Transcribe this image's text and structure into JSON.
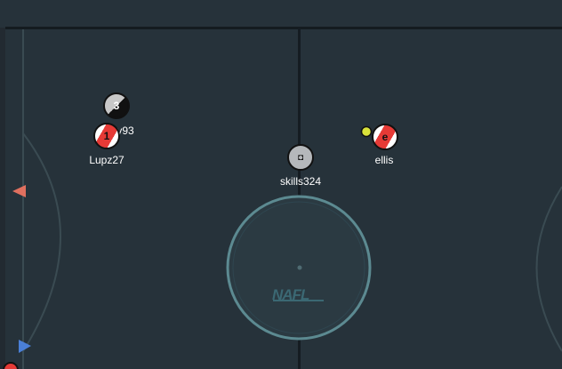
{
  "players": [
    {
      "id": "p3",
      "name": "A         lay93",
      "number": "3",
      "team": "blue"
    },
    {
      "id": "p1",
      "name": "Lupz27",
      "number": "1",
      "team": "red"
    },
    {
      "id": "pskills",
      "name": "skills324",
      "number": "",
      "team": "neutral"
    },
    {
      "id": "pellis",
      "name": "ellis",
      "number": "e",
      "team": "red"
    }
  ],
  "logo_text": "NAFL",
  "colors": {
    "field": "#26323a",
    "red_team": "#e63a36",
    "blue_team": "#4a7fd6",
    "ring": "#5c8a91",
    "ball": "#d9e23a"
  },
  "icons": [
    "red-team-marker-icon",
    "blue-team-marker-icon",
    "ball-icon"
  ]
}
